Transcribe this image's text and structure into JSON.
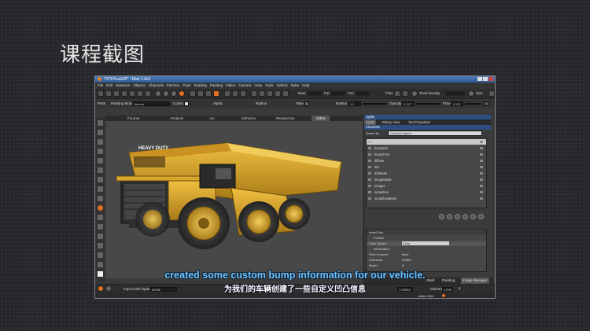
{
  "slide": {
    "title": "课程截图"
  },
  "window": {
    "title": "797bTruck02* - Mari 1.4v2"
  },
  "menu": [
    "File",
    "Edit",
    "Selection",
    "Objects",
    "Channels",
    "Patches",
    "Paint",
    "Shading",
    "Painting",
    "Filters",
    "Camera",
    "View",
    "Tools",
    "Python",
    "Nuke",
    "Help"
  ],
  "toolbar": {
    "near_label": "Near",
    "far_label": "Far",
    "fov_label": "Fov",
    "flies_label": "Flies",
    "texel_label": "Texel density",
    "size_label": "Size"
  },
  "paintbar": {
    "paint_label": "Paint",
    "mode_label": "Painting Mode",
    "mode_value": "Normal",
    "colors_label": "Colors",
    "alpha_label": "Alpha",
    "radius_label": "Radius",
    "flow_label": "Flow",
    "radius2_label": "Radius",
    "radius2_value": "10",
    "opacity_label": "Opacity",
    "opacity_value": "0.327",
    "flow2_label": "Flow",
    "flow2_value": "1.000"
  },
  "view_tabs": [
    "Forums",
    "Projects",
    "Uv",
    "Ortho/Uv",
    "Perspective",
    "Ortho"
  ],
  "view_tab_active": 5,
  "truck_label": "HEAVY DUTY",
  "right_panel": {
    "header": "Lights",
    "tabs": [
      "Lights",
      "History View",
      "Tool Properties"
    ],
    "sub_header": "Channels",
    "sorted_by_label": "Sorted by",
    "sorted_by_value": "Channel Name",
    "channels": [
      "bumpDirt",
      "bumpTires",
      "diffuse",
      "dirt",
      "dirtMask",
      "imageMask",
      "images",
      "scratches",
      "scratchesMask"
    ]
  },
  "properties": [
    {
      "label": "baseColor",
      "kind": "head"
    },
    {
      "label": "Format",
      "kind": "sub"
    },
    {
      "label": "Color Space",
      "value": "Color",
      "kind": "combo"
    },
    {
      "label": "Information",
      "kind": "sub"
    },
    {
      "label": "Files Channel",
      "value": "false",
      "kind": "row"
    },
    {
      "label": "Channels",
      "value": "RGBA",
      "kind": "row"
    },
    {
      "label": "Depth",
      "value": "8",
      "kind": "row"
    }
  ],
  "shelf_tabs": [
    "Shelf",
    "Painting",
    "Image Manager"
  ],
  "statusbar": {
    "input_cs_label": "Input Color Space",
    "input_cs_value": "sRGB",
    "gamma_label": "Gamma",
    "gamma_value": "1.000",
    "zoom_value": "1.00000"
  },
  "bottom": {
    "memory": "1dBm 2004"
  },
  "subtitles": {
    "en": "created some custom bump information for our vehicle.",
    "cn": "为我们的车辆创建了一些自定义凹凸信息"
  },
  "colors": {
    "accent": "#e07020",
    "truck": "#d9a52a",
    "bg": "#26272b"
  }
}
